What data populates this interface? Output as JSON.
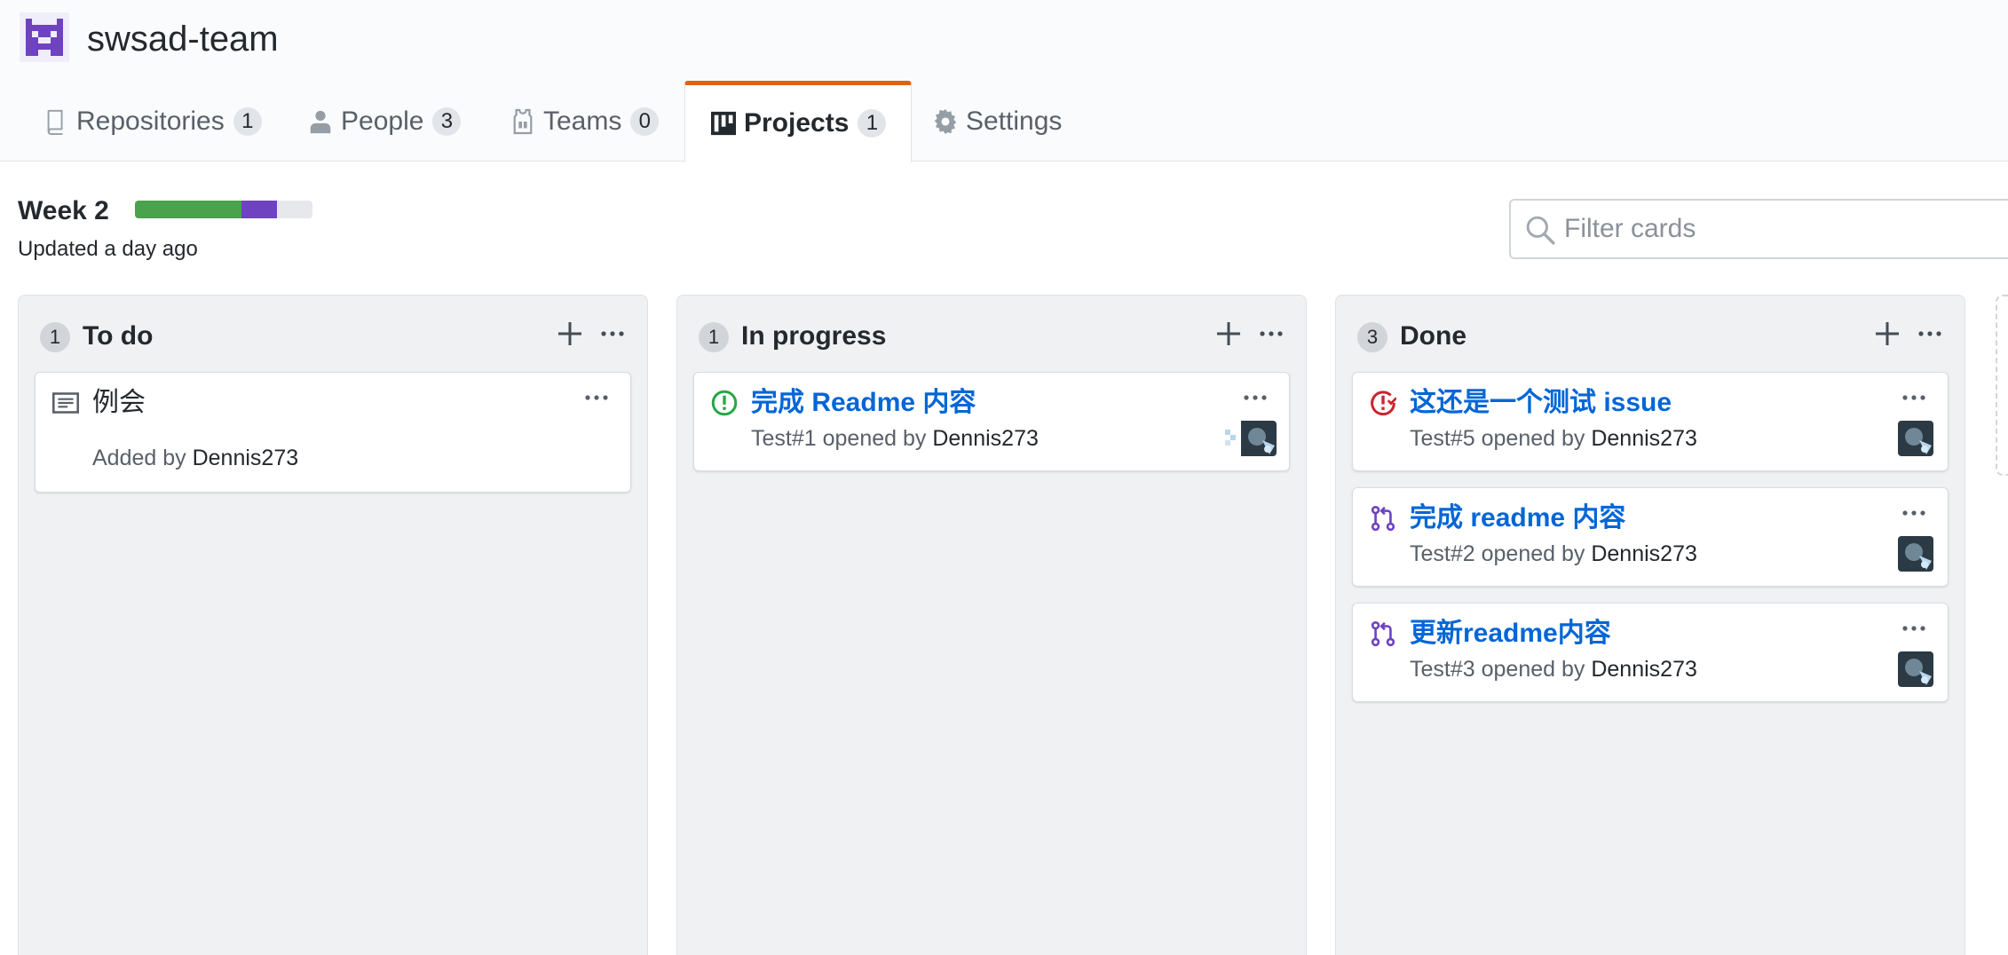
{
  "org": {
    "name": "swsad-team"
  },
  "tabs": [
    {
      "label": "Repositories",
      "count": "1",
      "icon": "repo-icon"
    },
    {
      "label": "People",
      "count": "3",
      "icon": "person-icon"
    },
    {
      "label": "Teams",
      "count": "0",
      "icon": "jersey-icon"
    },
    {
      "label": "Projects",
      "count": "1",
      "icon": "project-icon",
      "selected": true
    },
    {
      "label": "Settings",
      "icon": "gear-icon"
    }
  ],
  "project": {
    "name": "Week 2",
    "updated": "Updated a day ago",
    "progress": {
      "done": 0.6,
      "in_progress": 0.2,
      "todo": 0.2
    },
    "colors": {
      "done": "#4aa24c",
      "in_progress": "#6f42c1",
      "todo": "#e6e8eb"
    }
  },
  "filter": {
    "placeholder": "Filter cards",
    "value": ""
  },
  "columns": [
    {
      "count": "1",
      "title": "To do",
      "cards": [
        {
          "kind": "note",
          "icon": "note-icon",
          "title": "例会",
          "meta_prefix": "Added by",
          "author": "Dennis273"
        }
      ]
    },
    {
      "count": "1",
      "title": "In progress",
      "cards": [
        {
          "kind": "issue-open",
          "icon": "issue-opened-icon",
          "title": "完成 Readme 内容",
          "meta_prefix": "Test#1 opened by",
          "author": "Dennis273"
        }
      ]
    },
    {
      "count": "3",
      "title": "Done",
      "cards": [
        {
          "kind": "issue-closed",
          "icon": "issue-closed-icon",
          "title": "这还是一个测试 issue",
          "meta_prefix": "Test#5 opened by",
          "author": "Dennis273"
        },
        {
          "kind": "pull-request",
          "icon": "git-pull-request-icon",
          "title": "完成 readme 内容",
          "meta_prefix": "Test#2 opened by",
          "author": "Dennis273"
        },
        {
          "kind": "pull-request",
          "icon": "git-pull-request-icon",
          "title": "更新readme内容",
          "meta_prefix": "Test#3 opened by",
          "author": "Dennis273"
        }
      ]
    }
  ]
}
